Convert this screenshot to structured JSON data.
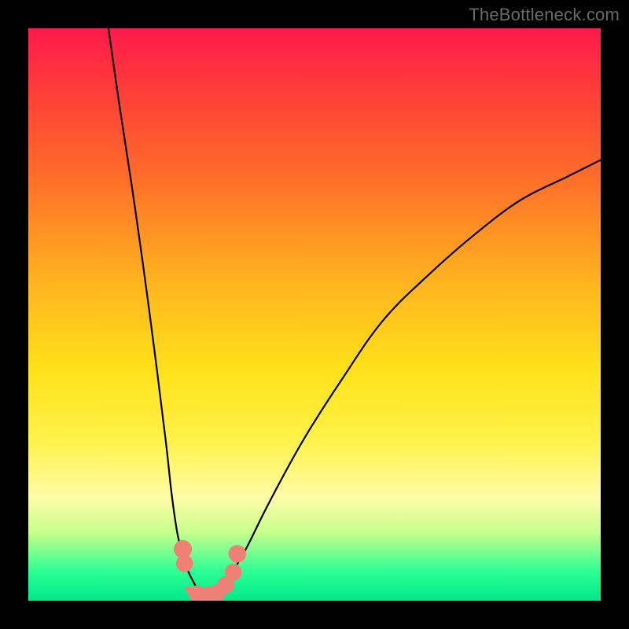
{
  "watermark": "TheBottleneck.com",
  "chart_data": {
    "type": "line",
    "title": "",
    "xlabel": "",
    "ylabel": "",
    "xlim": [
      0,
      100
    ],
    "ylim": [
      0,
      100
    ],
    "grid": false,
    "legend": false,
    "series": [
      {
        "name": "left-curve",
        "x": [
          14,
          16,
          18,
          20,
          22,
          24,
          25,
          26,
          27,
          28,
          29,
          30
        ],
        "y": [
          100,
          86,
          73,
          59,
          44,
          28,
          19,
          12,
          8,
          5,
          3,
          1
        ]
      },
      {
        "name": "right-curve",
        "x": [
          33,
          35,
          38,
          42,
          48,
          55,
          62,
          70,
          78,
          86,
          94,
          100
        ],
        "y": [
          1,
          4,
          9,
          17,
          28,
          39,
          49,
          57,
          64,
          70,
          74,
          77
        ]
      },
      {
        "name": "valley-floor",
        "x": [
          28,
          31,
          34
        ],
        "y": [
          2,
          1,
          2
        ]
      }
    ],
    "markers": [
      {
        "name": "left-dot-upper",
        "x": 27.0,
        "y": 9.0,
        "r": 1.8
      },
      {
        "name": "left-dot-lower",
        "x": 27.3,
        "y": 6.5,
        "r": 1.6
      },
      {
        "name": "floor-dot-1",
        "x": 29.5,
        "y": 1.2,
        "r": 1.6
      },
      {
        "name": "floor-dot-2",
        "x": 31.5,
        "y": 1.0,
        "r": 1.6
      },
      {
        "name": "floor-dot-3",
        "x": 33.0,
        "y": 1.4,
        "r": 1.6
      },
      {
        "name": "right-dot-1",
        "x": 34.5,
        "y": 2.8,
        "r": 1.6
      },
      {
        "name": "right-dot-2",
        "x": 35.8,
        "y": 5.0,
        "r": 1.6
      },
      {
        "name": "right-dot-upper",
        "x": 36.5,
        "y": 8.2,
        "r": 1.7
      }
    ],
    "marker_color": "#ee8075",
    "curve_color": "#000000"
  }
}
